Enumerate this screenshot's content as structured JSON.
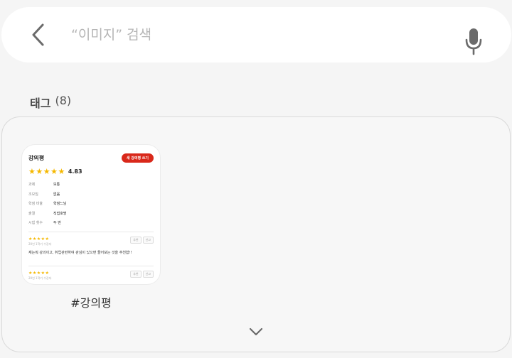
{
  "search": {
    "placeholder": "“이미지” 검색",
    "value": ""
  },
  "icons": {
    "back": "back-arrow-icon",
    "mic": "microphone-icon",
    "expand": "chevron-down-icon"
  },
  "section": {
    "title": "태그",
    "count": "(8)"
  },
  "tags": [
    {
      "label": "#강의평",
      "thumbnail": {
        "title": "강의평",
        "write_button": "새 강의평 쓰기",
        "stars": "★★★★★",
        "score": "4.83",
        "info": [
          {
            "label": "과제",
            "value": "보통"
          },
          {
            "label": "조모임",
            "value": "없음"
          },
          {
            "label": "학점 비율",
            "value": "학점느님"
          },
          {
            "label": "출결",
            "value": "직접호명"
          },
          {
            "label": "시험 횟수",
            "value": "두 번"
          }
        ],
        "reviews": [
          {
            "stars": "★★★★★",
            "date": "20년 1학기 수강자",
            "text": "재는뭐 강의이고, 취업관련하여 관심이 있으면 들어보는 것을 추천함!!",
            "like": "추천",
            "report": "신고"
          },
          {
            "stars": "★★★★★",
            "date": "20년 1학기 수강자",
            "text": "",
            "like": "추천",
            "report": "신고"
          }
        ]
      }
    }
  ],
  "colors": {
    "background": "#f5f5f5",
    "accent_red": "#d9281a",
    "star_yellow": "#f5b800",
    "icon_gray": "#6b6b6b"
  }
}
